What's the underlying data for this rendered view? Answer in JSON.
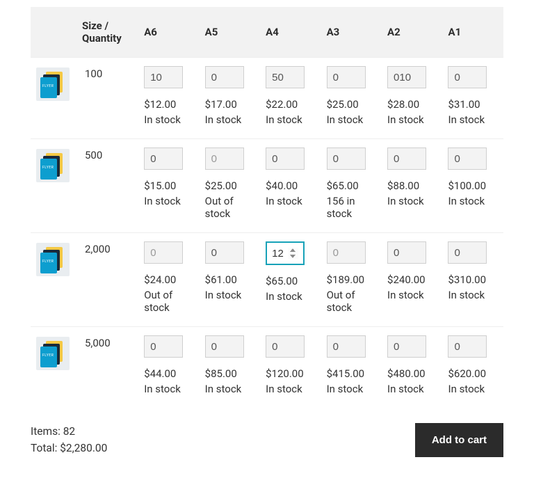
{
  "header": {
    "size_quantity": "Size / Quantity",
    "sizes": [
      "A6",
      "A5",
      "A4",
      "A3",
      "A2",
      "A1"
    ]
  },
  "rows": [
    {
      "quantity": "100",
      "cells": [
        {
          "value": "10",
          "price": "$12.00",
          "stock": "In stock",
          "zero": false,
          "active": false
        },
        {
          "value": "0",
          "price": "$17.00",
          "stock": "In stock",
          "zero": false,
          "active": false
        },
        {
          "value": "50",
          "price": "$22.00",
          "stock": "In stock",
          "zero": false,
          "active": false
        },
        {
          "value": "0",
          "price": "$25.00",
          "stock": "In stock",
          "zero": false,
          "active": false
        },
        {
          "value": "010",
          "price": "$28.00",
          "stock": "In stock",
          "zero": false,
          "active": false
        },
        {
          "value": "0",
          "price": "$31.00",
          "stock": "In stock",
          "zero": false,
          "active": false
        }
      ]
    },
    {
      "quantity": "500",
      "cells": [
        {
          "value": "0",
          "price": "$15.00",
          "stock": "In stock",
          "zero": false,
          "active": false
        },
        {
          "value": "0",
          "price": "$25.00",
          "stock": "Out of stock",
          "zero": true,
          "active": false
        },
        {
          "value": "0",
          "price": "$40.00",
          "stock": "In stock",
          "zero": false,
          "active": false
        },
        {
          "value": "0",
          "price": "$65.00",
          "stock": "156 in stock",
          "zero": false,
          "active": false
        },
        {
          "value": "0",
          "price": "$88.00",
          "stock": "In stock",
          "zero": false,
          "active": false
        },
        {
          "value": "0",
          "price": "$100.00",
          "stock": "In stock",
          "zero": false,
          "active": false
        }
      ]
    },
    {
      "quantity": "2,000",
      "cells": [
        {
          "value": "0",
          "price": "$24.00",
          "stock": "Out of stock",
          "zero": true,
          "active": false
        },
        {
          "value": "0",
          "price": "$61.00",
          "stock": "In stock",
          "zero": false,
          "active": false
        },
        {
          "value": "12",
          "price": "$65.00",
          "stock": "In stock",
          "zero": false,
          "active": true
        },
        {
          "value": "0",
          "price": "$189.00",
          "stock": "Out of stock",
          "zero": true,
          "active": false
        },
        {
          "value": "0",
          "price": "$240.00",
          "stock": "In stock",
          "zero": false,
          "active": false
        },
        {
          "value": "0",
          "price": "$310.00",
          "stock": "In stock",
          "zero": false,
          "active": false
        }
      ]
    },
    {
      "quantity": "5,000",
      "cells": [
        {
          "value": "0",
          "price": "$44.00",
          "stock": "In stock",
          "zero": false,
          "active": false
        },
        {
          "value": "0",
          "price": "$85.00",
          "stock": "In stock",
          "zero": false,
          "active": false
        },
        {
          "value": "0",
          "price": "$120.00",
          "stock": "In stock",
          "zero": false,
          "active": false
        },
        {
          "value": "0",
          "price": "$415.00",
          "stock": "In stock",
          "zero": false,
          "active": false
        },
        {
          "value": "0",
          "price": "$480.00",
          "stock": "In stock",
          "zero": false,
          "active": false
        },
        {
          "value": "0",
          "price": "$620.00",
          "stock": "In stock",
          "zero": false,
          "active": false
        }
      ]
    }
  ],
  "footer": {
    "items_label": "Items: 82",
    "total_label": "Total: $2,280.00",
    "add_to_cart": "Add to cart"
  }
}
